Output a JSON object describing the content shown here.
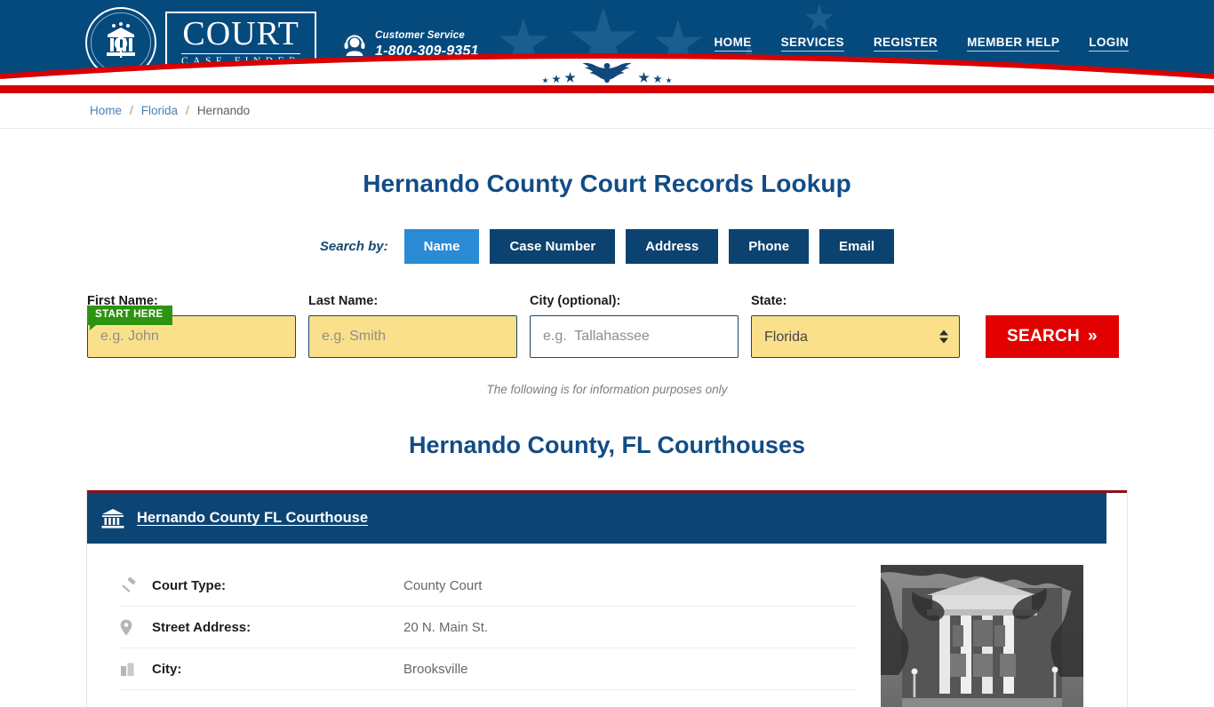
{
  "header": {
    "logo": {
      "word": "COURT",
      "sub": "CASE FINDER",
      "seal_icon": "court-seal-icon"
    },
    "customer_service": {
      "icon": "headset-support-icon",
      "label": "Customer Service",
      "phone": "1-800-309-9351"
    },
    "nav": [
      {
        "label": "HOME"
      },
      {
        "label": "SERVICES"
      },
      {
        "label": "REGISTER"
      },
      {
        "label": "MEMBER HELP"
      },
      {
        "label": "LOGIN"
      }
    ],
    "emblem_icon": "eagle-emblem-icon",
    "bg_navy": "#054a7d",
    "accent_red": "#d80000"
  },
  "breadcrumb": {
    "items": [
      {
        "label": "Home",
        "current": false
      },
      {
        "label": "Florida",
        "current": false
      },
      {
        "label": "Hernando",
        "current": true
      }
    ],
    "separator": "/"
  },
  "main": {
    "page_title": "Hernando County Court Records Lookup",
    "search_by_label": "Search by:",
    "tabs": [
      {
        "label": "Name",
        "active": true
      },
      {
        "label": "Case Number",
        "active": false
      },
      {
        "label": "Address",
        "active": false
      },
      {
        "label": "Phone",
        "active": false
      },
      {
        "label": "Email",
        "active": false
      }
    ],
    "start_here_badge": "START HERE",
    "fields": {
      "first_name": {
        "label": "First Name:",
        "placeholder": "e.g. John",
        "value": ""
      },
      "last_name": {
        "label": "Last Name:",
        "placeholder": "e.g. Smith",
        "value": ""
      },
      "city": {
        "label": "City (optional):",
        "placeholder": "e.g.  Tallahassee",
        "value": ""
      },
      "state": {
        "label": "State:",
        "value": "Florida",
        "options": [
          "Florida"
        ]
      }
    },
    "search_button": {
      "label": "SEARCH",
      "chevron": "»"
    },
    "disclaimer": "The following is for information purposes only",
    "section_title": "Hernando County, FL Courthouses"
  },
  "courthouse": {
    "icon": "bank-courthouse-icon",
    "name": "Hernando County FL Courthouse",
    "photo_alt": "courthouse-photo",
    "rows": [
      {
        "icon": "gavel-icon",
        "label": "Court Type:",
        "value": "County Court"
      },
      {
        "icon": "map-pin-icon",
        "label": "Street Address:",
        "value": "20 N. Main St."
      },
      {
        "icon": "city-icon",
        "label": "City:",
        "value": "Brooksville"
      }
    ]
  }
}
